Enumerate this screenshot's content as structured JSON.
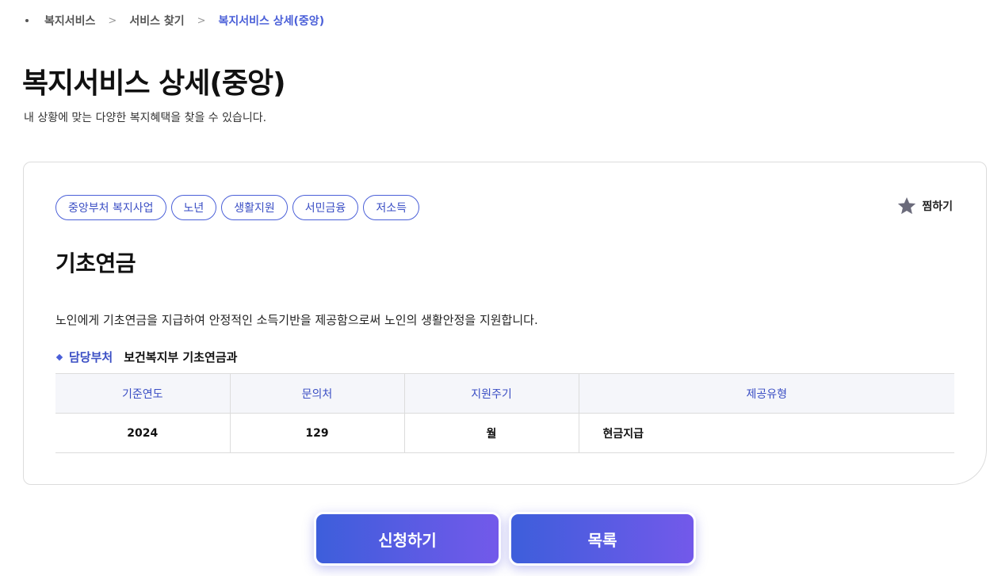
{
  "breadcrumb": {
    "items": [
      "복지서비스",
      "서비스 찾기",
      "복지서비스 상세(중앙)"
    ],
    "separator": ">"
  },
  "page": {
    "title": "복지서비스 상세(중앙)",
    "subtitle": "내 상황에 맞는 다양한 복지혜택을 찾을 수 있습니다."
  },
  "service": {
    "tags": [
      "중앙부처 복지사업",
      "노년",
      "생활지원",
      "서민금융",
      "저소득"
    ],
    "favorite_label": "찜하기",
    "name": "기초연금",
    "description": "노인에게 기초연금을 지급하여 안정적인 소득기반을 제공함으로써 노인의 생활안정을 지원합니다.",
    "department": {
      "label": "담당부처",
      "value": "보건복지부 기초연금과"
    },
    "table": {
      "headers": [
        "기준연도",
        "문의처",
        "지원주기",
        "제공유형"
      ],
      "row": [
        "2024",
        "129",
        "월",
        "현금지급"
      ]
    }
  },
  "actions": {
    "apply_label": "신청하기",
    "list_label": "목록"
  },
  "colors": {
    "accent": "#4a5fd8",
    "button_gradient_start": "#3d5edb",
    "button_gradient_end": "#7359ea",
    "star": "#6b6b7b"
  },
  "icons": {
    "favorite": "star-icon",
    "breadcrumb_home": "dot-icon",
    "breadcrumb_separator": "chevron-right-icon",
    "department_bullet": "diamond-icon"
  }
}
